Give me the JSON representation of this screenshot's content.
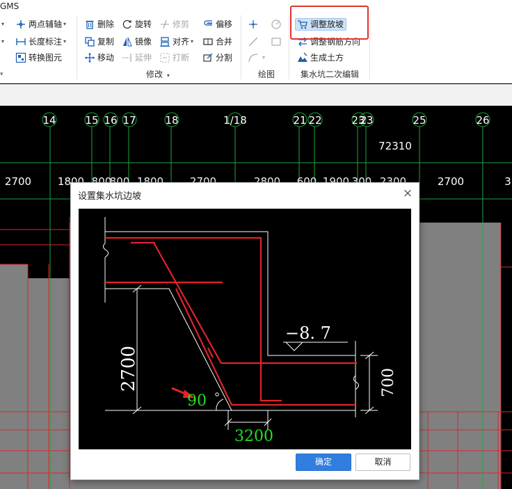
{
  "app": {
    "title": "GMS"
  },
  "ribbon": {
    "col1": {
      "two_point_axis": "两点辅轴",
      "length_dim": "长度标注",
      "convert_element": "转换图元"
    },
    "modify": {
      "delete": "删除",
      "rotate": "旋转",
      "trim": "修剪",
      "offset": "偏移",
      "copy": "复制",
      "mirror": "镜像",
      "align": "对齐",
      "merge": "合并",
      "move": "移动",
      "extend": "延伸",
      "break": "打断",
      "split": "分割",
      "group_label": "修改"
    },
    "draw": {
      "group_label": "绘图"
    },
    "sump": {
      "adjust_slope": "调整放坡",
      "adjust_rebar_direction": "调整钢筋方向",
      "generate_earthwork": "生成土方",
      "group_label": "集水坑二次编辑"
    }
  },
  "canvas": {
    "axis_labels": [
      "14",
      "15",
      "16",
      "17",
      "18",
      "1/18",
      "21",
      "22",
      "23",
      "23",
      "25",
      "26"
    ],
    "dims_row1": {
      "total": "72310"
    },
    "dims_row2": [
      "2700",
      "1800",
      "800",
      "800",
      "1800",
      "2700",
      "2800",
      "600",
      "1900",
      "300",
      "2300",
      "2700",
      "3"
    ]
  },
  "dialog": {
    "title": "设置集水坑边坡",
    "close_glyph": "×",
    "diagram": {
      "elevation": "−8. 7",
      "depth": "2700",
      "angle": "90",
      "offset": "3200",
      "side_height": "700",
      "deg_mark": "°"
    },
    "ok_label": "确定",
    "cancel_label": "取消"
  }
}
